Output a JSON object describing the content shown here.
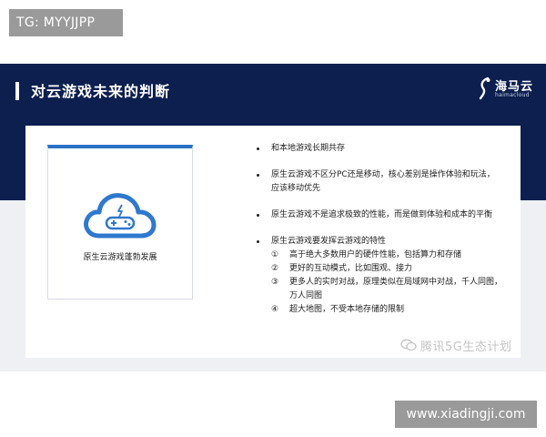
{
  "overlays": {
    "tg_label": "TG: MYYJJPP",
    "site_label": "www.xiadingji.com"
  },
  "slide": {
    "title": "对云游戏未来的判断",
    "logo": {
      "name": "海马云",
      "sub": "haimacloud",
      "icon": "haima-logo-icon"
    },
    "card": {
      "caption": "原生云游戏蓬勃发展",
      "icon": "cloud-gamepad-icon"
    },
    "bullets": [
      {
        "text": "和本地游戏长期共存"
      },
      {
        "text": "原生云游戏不区分PC还是移动，核心差别是操作体验和玩法，",
        "text2": "应该移动优先"
      },
      {
        "text": "原生云游戏不是追求极致的性能，而是做到体验和成本的平衡"
      },
      {
        "text": "原生云游戏要发挥云游戏的特性",
        "subs": [
          {
            "num": "①",
            "text": "高于绝大多数用户的硬件性能，包括算力和存储"
          },
          {
            "num": "②",
            "text": "更好的互动模式，比如围观、接力"
          },
          {
            "num": "③",
            "text": "更多人的实时对战，原理类似在局域网中对战，千人同图，",
            "text2": "万人同图"
          },
          {
            "num": "④",
            "text": "超大地图，不受本地存储的限制"
          }
        ]
      }
    ],
    "watermark": "腾讯5G生态计划"
  },
  "colors": {
    "header_bg": "#0c1f4f",
    "accent": "#2a72c8",
    "overlay_bg": "#9a9a9a"
  }
}
